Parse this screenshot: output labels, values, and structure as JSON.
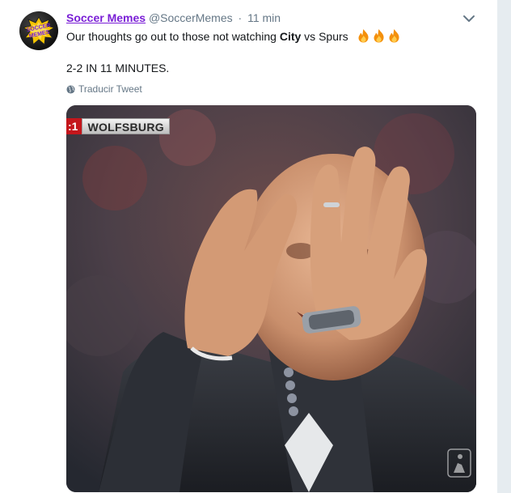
{
  "tweet": {
    "display_name": "Soccer Memes",
    "handle": "@SoccerMemes",
    "separator": "·",
    "time": "11 min",
    "text_before": "Our thoughts go out to those not watching ",
    "text_bold": "City",
    "text_after": " vs Spurs",
    "line2": "2-2 IN 11 MINUTES.",
    "translate_label": "Traducir Tweet",
    "fire_count": 3
  },
  "avatar": {
    "logo_text_line1": "SOCCER",
    "logo_text_line2": "MEMES"
  },
  "media": {
    "scorebug_score": ":1",
    "scorebug_team": "WOLFSBURG"
  },
  "colors": {
    "display_name": "#7a1fd6",
    "muted": "#657786",
    "text": "#14171a",
    "scorebug_red": "#c4161c"
  },
  "icons": [
    "chevron-down-icon",
    "globe-icon",
    "fire-emoji-icon"
  ]
}
